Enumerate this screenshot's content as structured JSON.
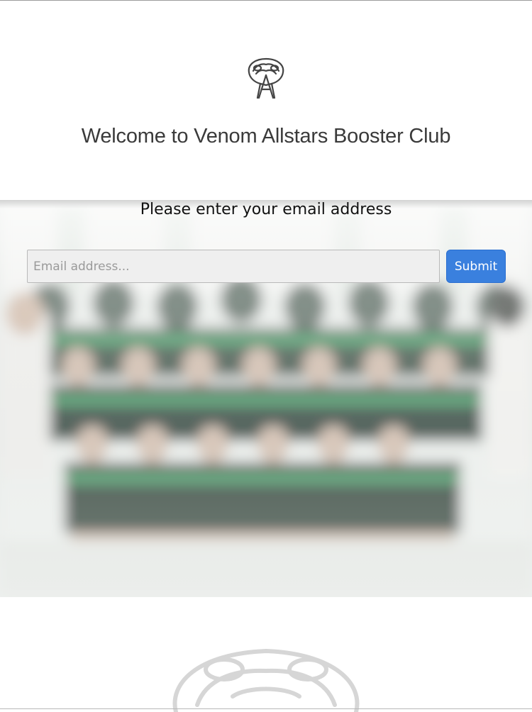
{
  "header": {
    "logo_icon": "venom-allstars-snake-logo",
    "welcome_text": "Welcome to Venom Allstars Booster Club"
  },
  "form": {
    "prompt": "Please enter your email address",
    "email_value": "",
    "email_placeholder": "Email address...",
    "submit_label": "Submit"
  },
  "background": {
    "image": "blurred-team-photo",
    "watermark_icon": "snake-head-watermark"
  },
  "colors": {
    "accent": "#3a80de",
    "jersey_green": "#3c9a60"
  }
}
